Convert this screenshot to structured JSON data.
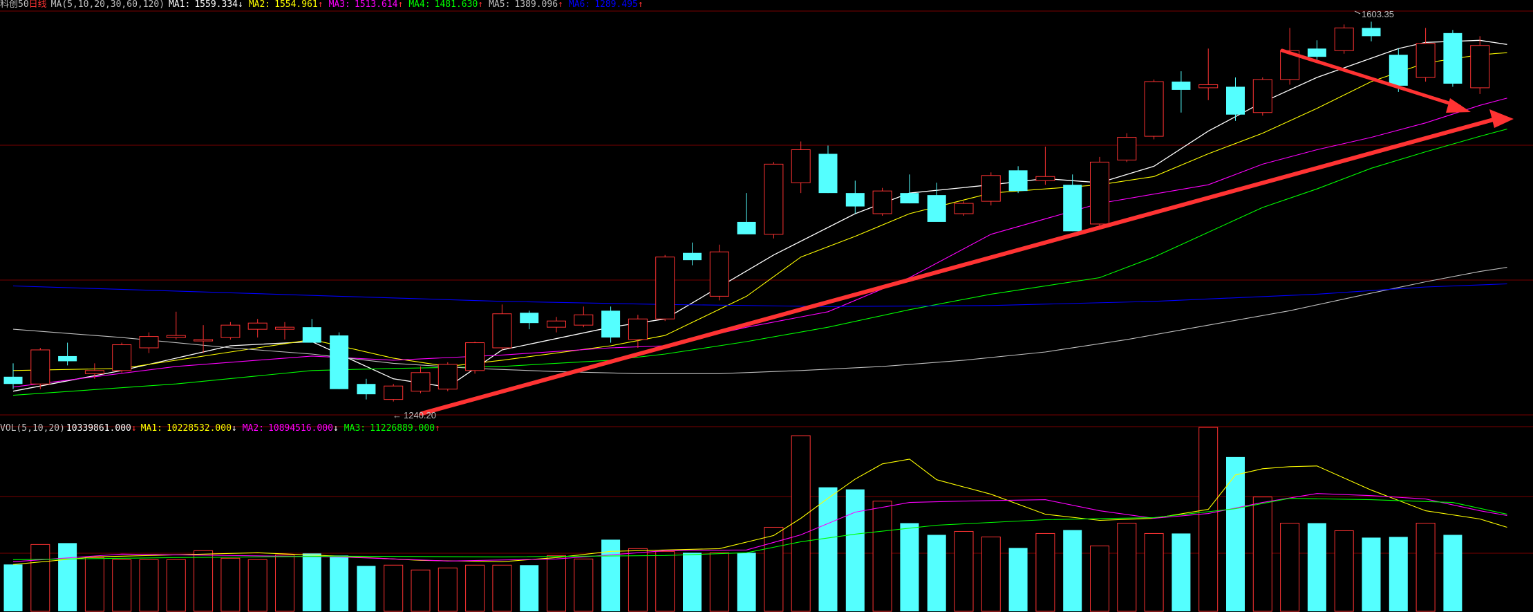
{
  "price_header": {
    "name": "科创50",
    "period": "日线",
    "ma_label": "MA(5,10,20,30,60,120)",
    "items": [
      {
        "label": "MA1:",
        "value": "1559.334",
        "arrow": "↓",
        "color": "#ffffff"
      },
      {
        "label": "MA2:",
        "value": "1554.961",
        "arrow": "↑",
        "color": "#ffff00"
      },
      {
        "label": "MA3:",
        "value": "1513.614",
        "arrow": "↑",
        "color": "#ff00ff"
      },
      {
        "label": "MA4:",
        "value": "1481.630",
        "arrow": "↑",
        "color": "#00ff00"
      },
      {
        "label": "MA5:",
        "value": "1389.096",
        "arrow": "↑",
        "color": "#c0c0c0"
      },
      {
        "label": "MA6:",
        "value": "1289.495",
        "arrow": "↑",
        "color": "#0000ff"
      }
    ]
  },
  "volume_header": {
    "label": "VOL(5,10,20)",
    "value": "10339861.000",
    "arrow": "↓",
    "items": [
      {
        "label": "MA1:",
        "value": "10228532.000",
        "arrow": "↓",
        "color": "#ffff00"
      },
      {
        "label": "MA2:",
        "value": "10894516.000",
        "arrow": "↓",
        "color": "#ff00ff"
      },
      {
        "label": "MA3:",
        "value": "11226889.000",
        "arrow": "↑",
        "color": "#00ff00"
      }
    ]
  },
  "annotations": {
    "high_label": "1603.35",
    "low_label": "1240.20"
  },
  "colors": {
    "up": "#ff3333",
    "down": "#54ffff",
    "grid": "#7a0000",
    "trend_arrow": "#ff3333"
  },
  "chart_data": {
    "type": "candlestick",
    "price_range": [
      1225,
      1615
    ],
    "volume_max": 25500000,
    "ohlc": [
      [
        1262,
        1275,
        1250,
        1255
      ],
      [
        1255,
        1290,
        1250,
        1288
      ],
      [
        1282,
        1295,
        1273,
        1277
      ],
      [
        1265,
        1275,
        1260,
        1268
      ],
      [
        1268,
        1295,
        1266,
        1293
      ],
      [
        1290,
        1305,
        1285,
        1301
      ],
      [
        1300,
        1325,
        1298,
        1302
      ],
      [
        1298,
        1312,
        1285,
        1298
      ],
      [
        1300,
        1315,
        1298,
        1312
      ],
      [
        1308,
        1318,
        1300,
        1314
      ],
      [
        1308,
        1315,
        1298,
        1310
      ],
      [
        1310,
        1318,
        1305,
        1295
      ],
      [
        1302,
        1305,
        1250,
        1250
      ],
      [
        1255,
        1260,
        1240,
        1245
      ],
      [
        1240,
        1255,
        1238,
        1253
      ],
      [
        1248,
        1272,
        1246,
        1266
      ],
      [
        1250,
        1276,
        1248,
        1274
      ],
      [
        1268,
        1296,
        1265,
        1295
      ],
      [
        1290,
        1332,
        1288,
        1323
      ],
      [
        1324,
        1326,
        1308,
        1314
      ],
      [
        1310,
        1320,
        1305,
        1316
      ],
      [
        1312,
        1330,
        1310,
        1322
      ],
      [
        1326,
        1330,
        1295,
        1300
      ],
      [
        1298,
        1322,
        1290,
        1318
      ],
      [
        1318,
        1380,
        1316,
        1378
      ],
      [
        1382,
        1392,
        1370,
        1375
      ],
      [
        1340,
        1390,
        1336,
        1383
      ],
      [
        1412,
        1440,
        1405,
        1400
      ],
      [
        1400,
        1470,
        1396,
        1468
      ],
      [
        1450,
        1490,
        1440,
        1482
      ],
      [
        1478,
        1486,
        1440,
        1440
      ],
      [
        1440,
        1452,
        1420,
        1427
      ],
      [
        1420,
        1445,
        1418,
        1442
      ],
      [
        1440,
        1458,
        1430,
        1430
      ],
      [
        1438,
        1450,
        1415,
        1412
      ],
      [
        1420,
        1432,
        1418,
        1430
      ],
      [
        1432,
        1460,
        1428,
        1457
      ],
      [
        1462,
        1466,
        1440,
        1442
      ],
      [
        1452,
        1485,
        1448,
        1456
      ],
      [
        1448,
        1458,
        1403,
        1403
      ],
      [
        1410,
        1475,
        1408,
        1470
      ],
      [
        1472,
        1498,
        1470,
        1494
      ],
      [
        1495,
        1550,
        1492,
        1548
      ],
      [
        1548,
        1558,
        1518,
        1540
      ],
      [
        1542,
        1580,
        1530,
        1545
      ],
      [
        1543,
        1552,
        1510,
        1516
      ],
      [
        1518,
        1552,
        1515,
        1550
      ],
      [
        1550,
        1600,
        1545,
        1578
      ],
      [
        1580,
        1588,
        1568,
        1572
      ],
      [
        1578,
        1603.35,
        1575,
        1600
      ],
      [
        1600,
        1606,
        1587,
        1592
      ],
      [
        1574,
        1580,
        1538,
        1544
      ],
      [
        1552,
        1600,
        1548,
        1585
      ],
      [
        1595,
        1598,
        1543,
        1546
      ],
      [
        1542,
        1592,
        1536,
        1583
      ]
    ],
    "volume": [
      6.8,
      9.7,
      9.9,
      7.8,
      7.5,
      7.5,
      7.5,
      8.8,
      7.7,
      7.5,
      8.2,
      8.4,
      8.1,
      6.6,
      6.7,
      6.0,
      6.3,
      6.7,
      6.7,
      6.7,
      8.1,
      7.6,
      10.4,
      9.1,
      8.7,
      8.5,
      8.5,
      8.5,
      12.2,
      25.5,
      18.0,
      17.7,
      16.0,
      12.8,
      11.1,
      11.6,
      10.8,
      9.2,
      11.3,
      11.8,
      9.5,
      12.8,
      11.3,
      11.3,
      26.7,
      22.4,
      16.6,
      12.8,
      12.8,
      11.7,
      10.7,
      10.8,
      12.8,
      11.1
    ],
    "ma_price": [
      {
        "name": "MA1",
        "color": "#ffffff",
        "width": 1.3,
        "values": [
          [
            0,
            1248
          ],
          [
            4,
            1268
          ],
          [
            8,
            1292
          ],
          [
            11,
            1296
          ],
          [
            14,
            1260
          ],
          [
            16,
            1252
          ],
          [
            18,
            1288
          ],
          [
            22,
            1310
          ],
          [
            24,
            1318
          ],
          [
            28,
            1380
          ],
          [
            31,
            1420
          ],
          [
            33,
            1440
          ],
          [
            36,
            1448
          ],
          [
            38,
            1454
          ],
          [
            40,
            1450
          ],
          [
            42,
            1466
          ],
          [
            44,
            1500
          ],
          [
            46,
            1528
          ],
          [
            48,
            1552
          ],
          [
            51,
            1580
          ],
          [
            52,
            1586
          ],
          [
            54,
            1588
          ],
          [
            55,
            1584
          ]
        ]
      },
      {
        "name": "MA2",
        "color": "#ffff00",
        "width": 1.1,
        "values": [
          [
            0,
            1268
          ],
          [
            4,
            1270
          ],
          [
            8,
            1286
          ],
          [
            11,
            1298
          ],
          [
            14,
            1280
          ],
          [
            16,
            1272
          ],
          [
            18,
            1278
          ],
          [
            22,
            1292
          ],
          [
            24,
            1302
          ],
          [
            27,
            1340
          ],
          [
            29,
            1378
          ],
          [
            31,
            1398
          ],
          [
            33,
            1420
          ],
          [
            36,
            1440
          ],
          [
            40,
            1448
          ],
          [
            42,
            1456
          ],
          [
            44,
            1478
          ],
          [
            46,
            1498
          ],
          [
            48,
            1522
          ],
          [
            50,
            1548
          ],
          [
            52,
            1566
          ],
          [
            54,
            1574
          ],
          [
            55,
            1576
          ]
        ]
      },
      {
        "name": "MA3",
        "color": "#ff00ff",
        "width": 1.1,
        "values": [
          [
            0,
            1252
          ],
          [
            6,
            1272
          ],
          [
            11,
            1282
          ],
          [
            14,
            1278
          ],
          [
            18,
            1283
          ],
          [
            22,
            1290
          ],
          [
            24,
            1292
          ],
          [
            27,
            1310
          ],
          [
            30,
            1325
          ],
          [
            33,
            1358
          ],
          [
            36,
            1400
          ],
          [
            40,
            1430
          ],
          [
            44,
            1448
          ],
          [
            46,
            1468
          ],
          [
            48,
            1482
          ],
          [
            50,
            1494
          ],
          [
            52,
            1508
          ],
          [
            54,
            1525
          ],
          [
            55,
            1532
          ]
        ]
      },
      {
        "name": "MA4",
        "color": "#00ff00",
        "width": 1.1,
        "values": [
          [
            0,
            1244
          ],
          [
            6,
            1255
          ],
          [
            11,
            1268
          ],
          [
            14,
            1270
          ],
          [
            18,
            1272
          ],
          [
            22,
            1278
          ],
          [
            24,
            1284
          ],
          [
            27,
            1296
          ],
          [
            30,
            1310
          ],
          [
            33,
            1327
          ],
          [
            36,
            1342
          ],
          [
            40,
            1358
          ],
          [
            42,
            1378
          ],
          [
            44,
            1402
          ],
          [
            46,
            1426
          ],
          [
            48,
            1444
          ],
          [
            50,
            1464
          ],
          [
            52,
            1480
          ],
          [
            54,
            1495
          ],
          [
            55,
            1502
          ]
        ]
      },
      {
        "name": "MA5",
        "color": "#c0c0c0",
        "width": 1.1,
        "values": [
          [
            0,
            1308
          ],
          [
            4,
            1300
          ],
          [
            8,
            1290
          ],
          [
            11,
            1284
          ],
          [
            14,
            1275
          ],
          [
            17,
            1270
          ],
          [
            20,
            1267
          ],
          [
            23,
            1265
          ],
          [
            26,
            1265
          ],
          [
            29,
            1268
          ],
          [
            32,
            1272
          ],
          [
            35,
            1278
          ],
          [
            38,
            1286
          ],
          [
            41,
            1298
          ],
          [
            44,
            1312
          ],
          [
            47,
            1326
          ],
          [
            50,
            1343
          ],
          [
            52,
            1354
          ],
          [
            54,
            1364
          ],
          [
            55,
            1368
          ]
        ]
      },
      {
        "name": "MA6",
        "color": "#0000ff",
        "width": 1.1,
        "values": [
          [
            0,
            1350
          ],
          [
            6,
            1345
          ],
          [
            12,
            1340
          ],
          [
            18,
            1335
          ],
          [
            24,
            1332
          ],
          [
            30,
            1330
          ],
          [
            36,
            1331
          ],
          [
            42,
            1335
          ],
          [
            48,
            1342
          ],
          [
            52,
            1349
          ],
          [
            55,
            1352
          ]
        ]
      }
    ],
    "ma_volume": [
      {
        "name": "MA1",
        "color": "#ffff00",
        "values": [
          [
            0,
            6.8
          ],
          [
            3,
            7.9
          ],
          [
            6,
            8.2
          ],
          [
            9,
            8.5
          ],
          [
            12,
            8.0
          ],
          [
            15,
            7.4
          ],
          [
            18,
            7.2
          ],
          [
            20,
            7.8
          ],
          [
            22,
            8.7
          ],
          [
            24,
            8.9
          ],
          [
            26,
            9.1
          ],
          [
            28,
            11.0
          ],
          [
            29,
            13.5
          ],
          [
            30,
            16.4
          ],
          [
            31,
            19.2
          ],
          [
            32,
            21.4
          ],
          [
            33,
            22.1
          ],
          [
            34,
            19.1
          ],
          [
            36,
            17.0
          ],
          [
            38,
            14.1
          ],
          [
            40,
            13.2
          ],
          [
            42,
            13.5
          ],
          [
            44,
            14.8
          ],
          [
            45,
            19.8
          ],
          [
            46,
            20.7
          ],
          [
            47,
            21.0
          ],
          [
            48,
            21.1
          ],
          [
            50,
            17.6
          ],
          [
            52,
            14.6
          ],
          [
            54,
            13.4
          ],
          [
            55,
            12.2
          ]
        ]
      },
      {
        "name": "MA2",
        "color": "#ff00ff",
        "values": [
          [
            0,
            7.2
          ],
          [
            4,
            8.3
          ],
          [
            8,
            8.1
          ],
          [
            12,
            7.9
          ],
          [
            16,
            7.3
          ],
          [
            20,
            7.6
          ],
          [
            24,
            8.8
          ],
          [
            27,
            8.9
          ],
          [
            29,
            11.1
          ],
          [
            31,
            14.4
          ],
          [
            33,
            15.8
          ],
          [
            35,
            16.0
          ],
          [
            38,
            16.2
          ],
          [
            40,
            14.6
          ],
          [
            42,
            13.5
          ],
          [
            44,
            14.2
          ],
          [
            46,
            15.8
          ],
          [
            48,
            17.1
          ],
          [
            50,
            16.8
          ],
          [
            52,
            16.3
          ],
          [
            54,
            14.6
          ],
          [
            55,
            13.9
          ]
        ]
      },
      {
        "name": "MA3",
        "color": "#00ff00",
        "values": [
          [
            0,
            7.5
          ],
          [
            6,
            7.8
          ],
          [
            12,
            8.0
          ],
          [
            18,
            7.9
          ],
          [
            24,
            8.1
          ],
          [
            27,
            8.5
          ],
          [
            29,
            10.1
          ],
          [
            31,
            11.2
          ],
          [
            34,
            12.5
          ],
          [
            38,
            13.3
          ],
          [
            42,
            13.6
          ],
          [
            45,
            14.9
          ],
          [
            47,
            16.4
          ],
          [
            50,
            16.2
          ],
          [
            53,
            15.8
          ],
          [
            55,
            14.1
          ]
        ]
      }
    ]
  }
}
